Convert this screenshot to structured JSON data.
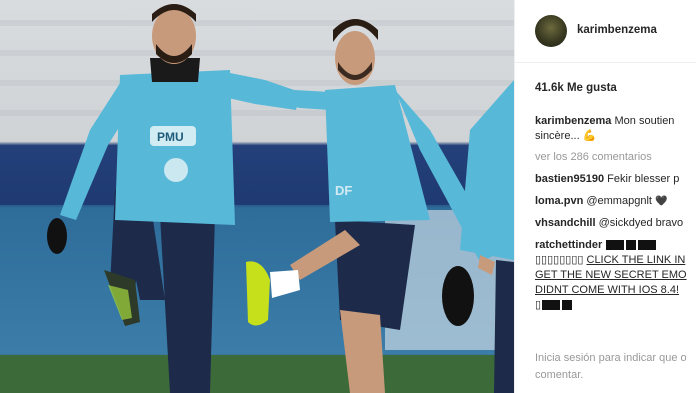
{
  "post": {
    "username": "karimbenzema",
    "likes": "41.6k Me gusta",
    "caption_user": "karimbenzema",
    "caption_line1": "Mon soutien",
    "caption_line2": "sincère...",
    "view_comments": "ver los 286 comentarios",
    "comments": [
      {
        "user": "bastien95190",
        "text": "Fekir blesser p"
      },
      {
        "user": "loma.pvn",
        "text": "@emmapgnlt"
      },
      {
        "user": "vhsandchill",
        "text": "@sickdyed bravo"
      },
      {
        "user": "ratchettinder",
        "lines": [
          "CLICK THE LINK IN",
          "GET THE NEW SECRET EMO",
          "DIDNT COME WITH IOS 8.4!"
        ],
        "prefix": "▯▯▯▯▯▯▯▯",
        "suffix": "▯"
      }
    ],
    "footer": "Inicia sesión para indicar que o comentar."
  },
  "photo": {
    "sponsor_text": "PMU",
    "jersey_text": "DF",
    "icons": [
      "heart-icon",
      "flexed-arm-icon"
    ]
  }
}
